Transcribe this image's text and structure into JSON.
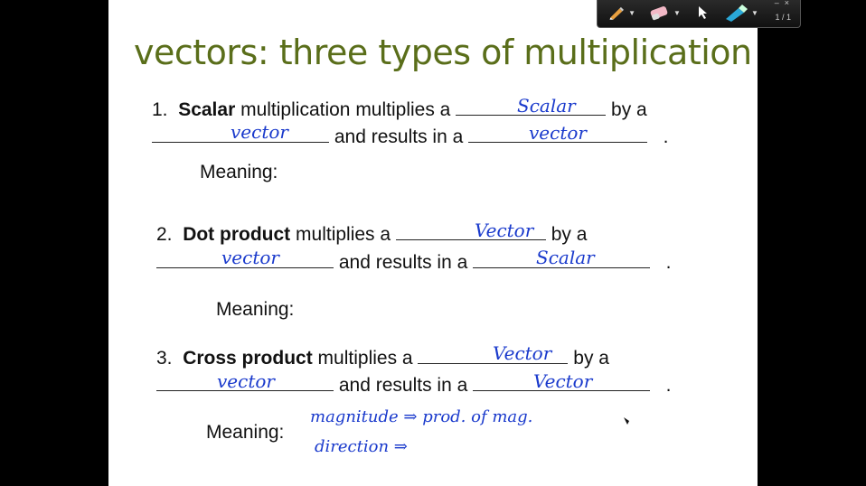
{
  "toolbar": {
    "pen_icon": "pen-icon",
    "eraser_icon": "eraser-icon",
    "pointer_icon": "pointer-icon",
    "highlighter_icon": "highlighter-icon",
    "page_indicator": "1 / 1",
    "minimize": "–",
    "close": "×"
  },
  "slide": {
    "title": "vectors: three types of multiplication",
    "items": [
      {
        "number": "1.",
        "bold": "Scalar",
        "text1": "multiplication multiplies a",
        "text2": "by a",
        "text3": "and results in a",
        "end": ".",
        "meaning": "Meaning:",
        "hw1": "Scalar",
        "hw2": "vector",
        "hw3": "vector"
      },
      {
        "number": "2.",
        "bold": "Dot product",
        "text1": "multiplies a",
        "text2": "by a",
        "text3": "and results in a",
        "end": ".",
        "meaning": "Meaning:",
        "hw1": "Vector",
        "hw2": "vector",
        "hw3": "Scalar"
      },
      {
        "number": "3.",
        "bold": "Cross product",
        "text1": "multiplies a",
        "text2": "by a",
        "text3": "and results in a",
        "end": ".",
        "meaning": "Meaning:",
        "hw1": "Vector",
        "hw2": "vector",
        "hw3": "Vector",
        "hw_meaning1": "magnitude ⇒ prod. of mag.",
        "hw_meaning2": "direction ⇒"
      }
    ]
  },
  "colors": {
    "title": "#5a6e1a",
    "ink": "#1a3acc",
    "background": "#000000",
    "slide": "#ffffff"
  }
}
